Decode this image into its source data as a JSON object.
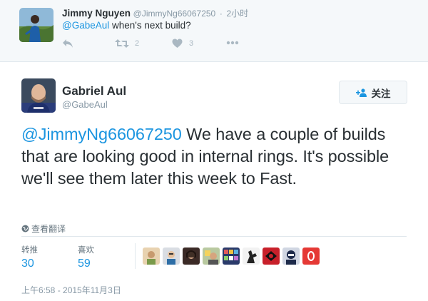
{
  "parent_tweet": {
    "avatar_icon": "user-avatar-jimmy",
    "name": "Jimmy Nguyen",
    "handle": "@JimmyNg66067250",
    "separator": "·",
    "time": "2小时",
    "mention": "@GabeAul",
    "text": " when's next build?",
    "actions": {
      "reply_icon": "reply-icon",
      "retweet_icon": "retweet-icon",
      "retweet_count": "2",
      "like_icon": "heart-icon",
      "like_count": "3",
      "more_icon": "more-icon"
    }
  },
  "main_tweet": {
    "avatar_icon": "user-avatar-gabriel",
    "name": "Gabriel Aul",
    "handle": "@GabeAul",
    "follow_label": "关注",
    "follow_icon": "follow-user-icon",
    "mention": "@JimmyNg66067250",
    "text": " We have a couple of builds that are looking good in internal rings. It's possible we'll see them later this week to Fast.",
    "translate_label": "查看翻译",
    "translate_icon": "globe-icon",
    "stats": {
      "retweets_label": "转推",
      "retweets": "30",
      "likes_label": "喜欢",
      "likes": "59"
    },
    "likers": [
      "liker-avatar-1",
      "liker-avatar-2",
      "liker-avatar-3",
      "liker-avatar-4",
      "liker-avatar-5",
      "liker-avatar-6",
      "liker-avatar-7",
      "liker-avatar-8",
      "liker-avatar-9"
    ],
    "timestamp": "上午6:58 - 2015年11月3日"
  },
  "colors": {
    "link": "#1b95e0",
    "text": "#292f33",
    "muted": "#8899a6",
    "parent_bg": "#f5f8fa"
  }
}
